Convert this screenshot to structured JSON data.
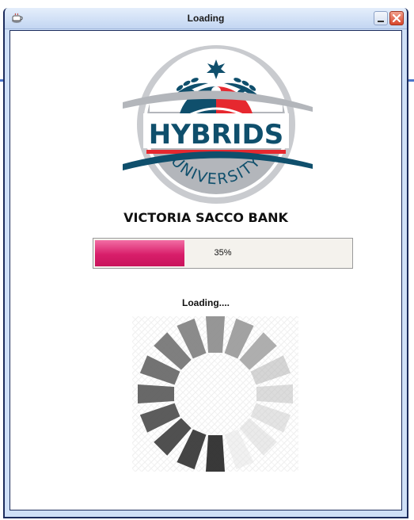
{
  "window": {
    "title": "Loading",
    "icon": "java-cup-icon",
    "minimize_icon": "minimize-icon",
    "close_icon": "close-icon"
  },
  "logo": {
    "name": "HYBRIDS",
    "subtitle": "UNIVERSITY",
    "colors": {
      "navy": "#0f4f6c",
      "red": "#e6282f",
      "silver": "#b3b6bb"
    }
  },
  "organization": "VICTORIA SACCO BANK",
  "progress": {
    "value": 0.35,
    "label": "35%",
    "fill_color": "#d81e6a"
  },
  "status": "Loading....",
  "spinner": {
    "icon": "loading-spinner-icon"
  }
}
